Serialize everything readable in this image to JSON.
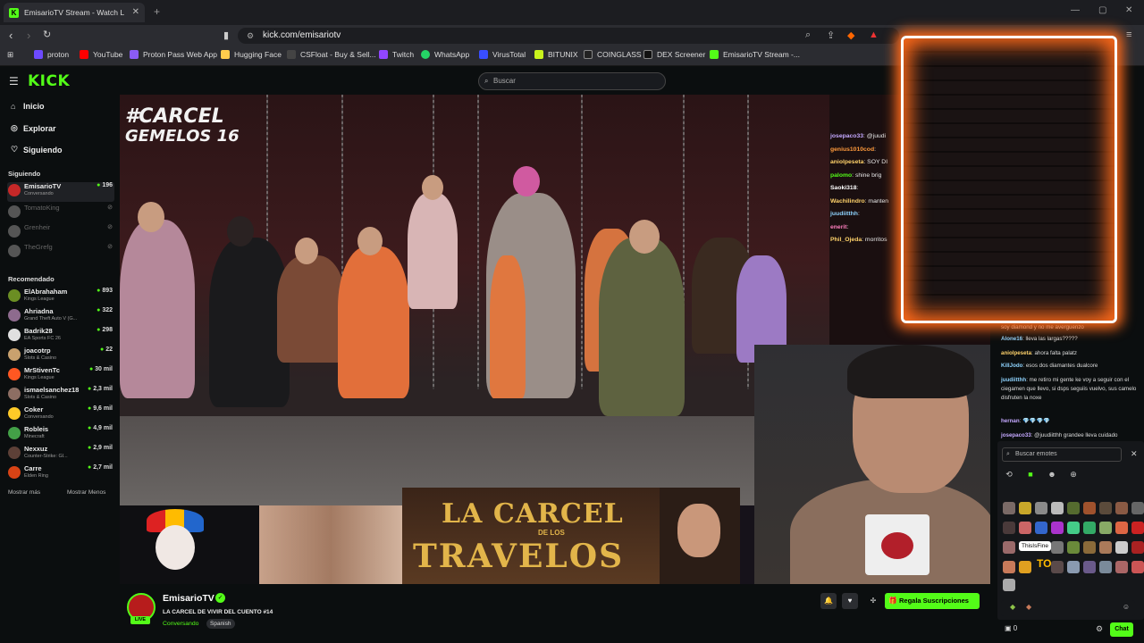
{
  "browser": {
    "tab_title": "EmisarioTV Stream - Watch L",
    "url": "kick.com/emisariotv",
    "bookmarks": [
      {
        "label": "proton",
        "color": "#6d4aff"
      },
      {
        "label": "YouTube",
        "color": "#ff0000"
      },
      {
        "label": "Proton Pass Web App",
        "color": "#8b5cf6"
      },
      {
        "label": "Hugging Face",
        "color": "#ffcc4d"
      },
      {
        "label": "CSFloat - Buy & Sell...",
        "color": "#444444"
      },
      {
        "label": "Twitch",
        "color": "#9146ff"
      },
      {
        "label": "WhatsApp",
        "color": "#25d366"
      },
      {
        "label": "VirusTotal",
        "color": "#394eff"
      },
      {
        "label": "BITUNIX",
        "color": "#c9f31d"
      },
      {
        "label": "COINGLASS",
        "color": "#222222"
      },
      {
        "label": "DEX Screener",
        "color": "#111111"
      },
      {
        "label": "EmisarioTV Stream -...",
        "color": "#53fc18"
      }
    ]
  },
  "header": {
    "logo": "KICK",
    "search_placeholder": "Buscar"
  },
  "sidebar": {
    "nav": [
      {
        "label": "Inicio",
        "icon": "home-icon"
      },
      {
        "label": "Explorar",
        "icon": "compass-icon"
      },
      {
        "label": "Siguiendo",
        "icon": "heart-icon"
      }
    ],
    "following_title": "Siguiendo",
    "following": [
      {
        "name": "EmisarioTV",
        "category": "Conversando",
        "viewers": "196",
        "color": "#c62828",
        "live": true
      },
      {
        "name": "TomatoKing",
        "category": "",
        "viewers": "",
        "color": "#555555",
        "live": false
      },
      {
        "name": "Grenheir",
        "category": "",
        "viewers": "",
        "color": "#555555",
        "live": false
      },
      {
        "name": "TheGrefg",
        "category": "",
        "viewers": "",
        "color": "#555555",
        "live": false
      }
    ],
    "recommended_title": "Recomendado",
    "recommended": [
      {
        "name": "ElAbrahaham",
        "category": "Kings League",
        "viewers": "893",
        "color": "#6b8e23"
      },
      {
        "name": "Ahriadna",
        "category": "Grand Theft Auto V (G...",
        "viewers": "322",
        "color": "#8e6b8e"
      },
      {
        "name": "Badrik28",
        "category": "EA Sports FC 26",
        "viewers": "298",
        "color": "#e0e0e0"
      },
      {
        "name": "joacotrp",
        "category": "Slots & Casino",
        "viewers": "22",
        "color": "#c9a16e"
      },
      {
        "name": "MrStivenTc",
        "category": "Kings League",
        "viewers": "30 mil",
        "color": "#ff5722"
      },
      {
        "name": "ismaelsanchez18",
        "category": "Slots & Casino",
        "viewers": "2,3 mil",
        "color": "#8d6e63"
      },
      {
        "name": "Coker",
        "category": "Conversando",
        "viewers": "9,6 mil",
        "color": "#ffca28"
      },
      {
        "name": "Robleis",
        "category": "Minecraft",
        "viewers": "4,9 mil",
        "color": "#43a047"
      },
      {
        "name": "Nexxuz",
        "category": "Counter-Strike: Gl...",
        "viewers": "2,9 mil",
        "color": "#5d4037"
      },
      {
        "name": "Carre",
        "category": "Elden Ring",
        "viewers": "2,7 mil",
        "color": "#d84315"
      }
    ],
    "show_more": "Mostrar más",
    "show_less": "Mostrar Menos"
  },
  "video": {
    "hashtag_line1": "#CARCEL",
    "hashtag_line2": "GEMELOS 16",
    "banner_line1": "LA CARCEL",
    "banner_line2": "DE LOS",
    "banner_line3": "TRAVELOS",
    "overlay_chat": [
      {
        "user": "josepaco33",
        "text": ": @juudi",
        "color": "#c4a8ff"
      },
      {
        "user": "genius1010cod",
        "text": ":",
        "color": "#ff9a3c"
      },
      {
        "user": "aniolpeseta",
        "text": ": SOY DI",
        "color": "#ffd36b"
      },
      {
        "user": "palomo",
        "text": ": shine brig",
        "color": "#53fc18"
      },
      {
        "user": "Saoki318",
        "text": ":",
        "color": "#ffffff"
      },
      {
        "user": "Wachilindro",
        "text": ": manten",
        "color": "#ffd36b"
      },
      {
        "user": "juudiitthh",
        "text": ":",
        "color": "#8fd4ff"
      },
      {
        "user": "enerit",
        "text": ":",
        "color": "#ff7fbf"
      },
      {
        "user": "Phil_Ojeda",
        "text": ": morritos",
        "color": "#ffd36b"
      }
    ]
  },
  "chat": {
    "messages": [
      {
        "user": "",
        "text": "soy diamond y no me averguenzo",
        "color": "#8fd4ff"
      },
      {
        "user": "Alone16",
        "text": ": lleva las largas?????",
        "color": "#8fd4ff"
      },
      {
        "user": "aniolpeseta",
        "text": ": ahora falta palatz",
        "color": "#ffd36b"
      },
      {
        "user": "KillJodo",
        "text": ": esos dos diamantes dualcore",
        "color": "#8fd4ff"
      },
      {
        "user": "juudiitthh",
        "text": ": me retiro mi gente ke voy a seguir con el ciegamen que llevo, si dsps seguiis vuelvo, sus camelo disfruten la noxe",
        "color": "#8fd4ff"
      },
      {
        "user": "hernan",
        "text": ": 💎💎💎💎",
        "color": "#c4a8ff"
      },
      {
        "user": "josepaco33",
        "text": ": @juudiitthh grandee lleva cuidado",
        "color": "#c4a8ff"
      }
    ],
    "emote_search_placeholder": "Buscar emotes",
    "tooltip": "ThisIsFine",
    "to_label": "TO",
    "points": "0",
    "chat_button": "Chat"
  },
  "stream": {
    "channel": "EmisarioTV",
    "live_badge": "LIVE",
    "title": "LA CARCEL DE VIVIR DEL CUENTO #14",
    "category": "Conversando",
    "tag": "Spanish",
    "subs_button": "Regala Suscripciones"
  }
}
